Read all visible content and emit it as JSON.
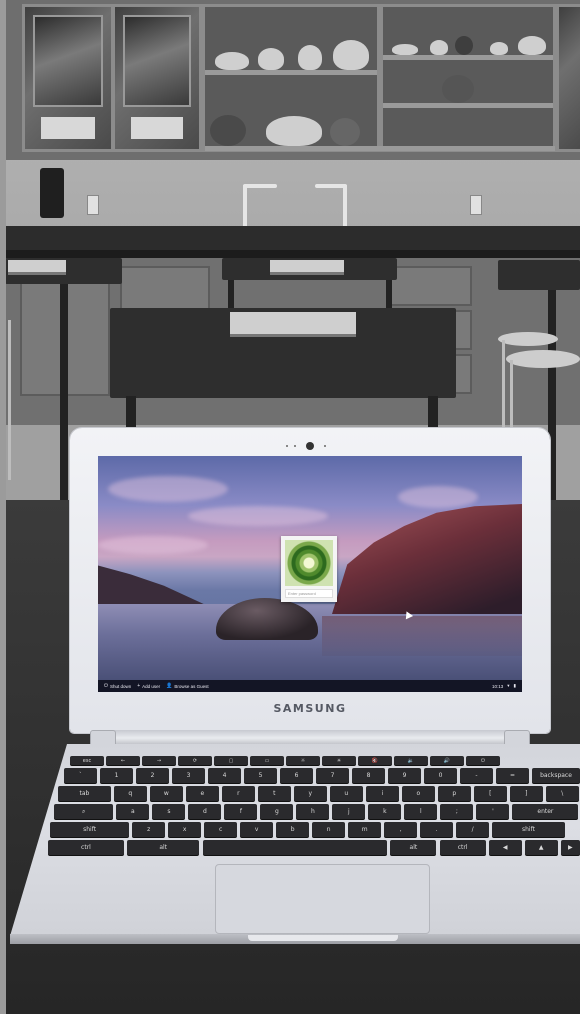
{
  "laptop": {
    "brand": "SAMSUNG"
  },
  "login_screen": {
    "user_pod_placeholder": "Enter password",
    "shelf": {
      "shut_down": "Shut down",
      "add_user": "Add user",
      "browse_as_guest": "Browse as Guest",
      "clock": "10:13"
    }
  },
  "keyboard": {
    "rows": [
      [
        "esc",
        "←",
        "→",
        "⟳",
        "▢",
        "▭",
        "☼",
        "☀",
        "🔇",
        "🔉",
        "🔊",
        "⏻"
      ],
      [
        "`",
        "1",
        "2",
        "3",
        "4",
        "5",
        "6",
        "7",
        "8",
        "9",
        "0",
        "-",
        "=",
        "backspace"
      ],
      [
        "tab",
        "q",
        "w",
        "e",
        "r",
        "t",
        "y",
        "u",
        "i",
        "o",
        "p",
        "[",
        "]",
        "\\"
      ],
      [
        "⌕",
        "a",
        "s",
        "d",
        "f",
        "g",
        "h",
        "j",
        "k",
        "l",
        ";",
        "'",
        "enter"
      ],
      [
        "shift",
        "z",
        "x",
        "c",
        "v",
        "b",
        "n",
        "m",
        ",",
        ".",
        "/",
        "shift"
      ],
      [
        "ctrl",
        "alt",
        "",
        "alt",
        "ctrl",
        "◀",
        "▲",
        "▶"
      ]
    ]
  },
  "icons": [
    "power-icon",
    "add-user-icon",
    "guest-icon",
    "wifi-icon",
    "battery-icon",
    "camera-icon",
    "cursor-icon"
  ]
}
